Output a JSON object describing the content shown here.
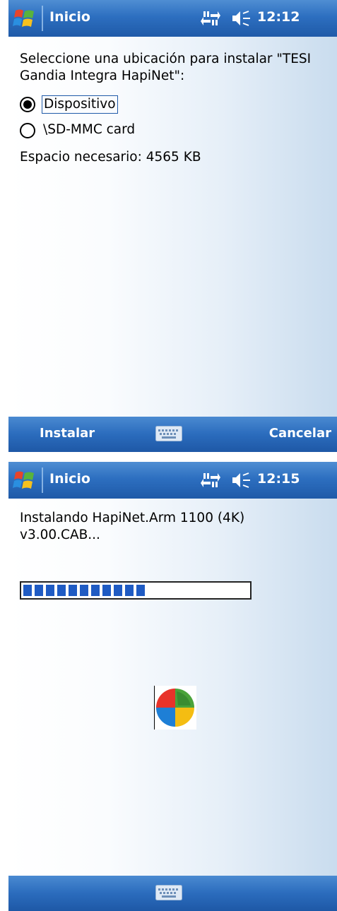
{
  "screen1": {
    "titlebar": {
      "title": "Inicio",
      "time": "12:12"
    },
    "prompt": "Seleccione una ubicación para instalar \"TESI Gandia Integra HapiNet\":",
    "options": [
      {
        "label": "Dispositivo",
        "selected": true
      },
      {
        "label": "\\SD-MMC card",
        "selected": false
      }
    ],
    "space_required": "Espacio necesario: 4565 KB",
    "softkeys": {
      "left": "Instalar",
      "right": "Cancelar"
    }
  },
  "screen2": {
    "titlebar": {
      "title": "Inicio",
      "time": "12:15"
    },
    "status": "Instalando HapiNet.Arm 1100 (4K) v3.00.CAB...",
    "progress": {
      "segments_filled": 11,
      "fraction": 0.6
    }
  },
  "icons": {
    "start": "windows-start-flag-icon",
    "connectivity": "connectivity-icon",
    "volume": "speaker-muted-icon",
    "keyboard": "keyboard-icon",
    "app": "windows-mobile-logo-icon"
  },
  "colors": {
    "bar_blue": "#2d6fc0",
    "progress_blue": "#1f5bc3"
  }
}
